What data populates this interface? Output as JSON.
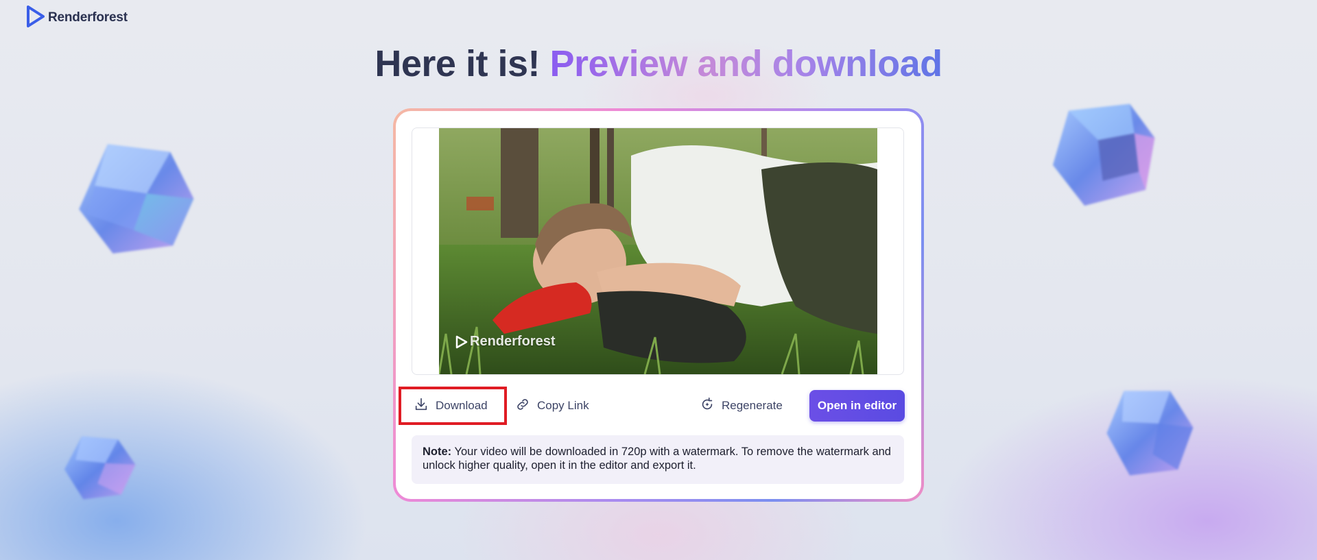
{
  "brand": {
    "name": "Renderforest",
    "logo_icon": "play-triangle-icon"
  },
  "heading": {
    "part1": "Here it is!",
    "part2": "Preview and download"
  },
  "video": {
    "watermark_text": "Renderforest"
  },
  "actions": {
    "download_label": "Download",
    "copy_link_label": "Copy Link",
    "regenerate_label": "Regenerate",
    "open_editor_label": "Open in editor"
  },
  "note": {
    "prefix": "Note:",
    "text": "Your video will be downloaded in 720p with a watermark. To remove the watermark and unlock higher quality, open it in the editor and export it."
  },
  "colors": {
    "accent": "#5a4be2",
    "highlight_border": "#e01c24",
    "heading_dark": "#2f3552"
  }
}
